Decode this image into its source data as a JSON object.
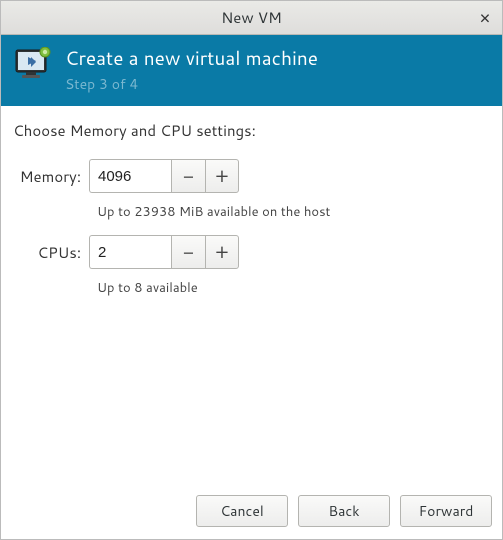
{
  "window": {
    "title": "New VM"
  },
  "banner": {
    "heading": "Create a new virtual machine",
    "step": "Step 3 of 4"
  },
  "section_heading": "Choose Memory and CPU settings:",
  "memory": {
    "label": "Memory:",
    "value": "4096",
    "hint": "Up to 23938 MiB available on the host"
  },
  "cpus": {
    "label": "CPUs:",
    "value": "2",
    "hint": "Up to 8 available"
  },
  "buttons": {
    "cancel": "Cancel",
    "back": "Back",
    "forward": "Forward"
  }
}
